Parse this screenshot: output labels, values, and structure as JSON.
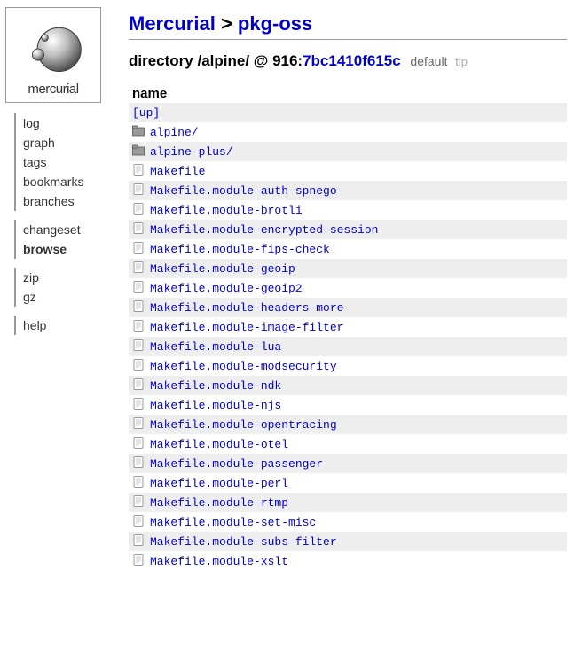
{
  "logo_text": "mercurial",
  "nav": {
    "group1": [
      "log",
      "graph",
      "tags",
      "bookmarks",
      "branches"
    ],
    "group2": [
      "changeset",
      "browse"
    ],
    "group3": [
      "zip",
      "gz"
    ],
    "group4": [
      "help"
    ],
    "active": "browse"
  },
  "breadcrumb": {
    "root": "Mercurial",
    "sep": " > ",
    "repo": "pkg-oss"
  },
  "subtitle": {
    "prefix": "directory /alpine/ @ 916:",
    "hash": "7bc1410f615c",
    "tag1": "default",
    "tag2": "tip"
  },
  "table_header": "name",
  "up_label": "[up]",
  "entries": [
    {
      "type": "dir",
      "name": "alpine/"
    },
    {
      "type": "dir",
      "name": "alpine-plus/"
    },
    {
      "type": "file",
      "name": "Makefile"
    },
    {
      "type": "file",
      "name": "Makefile.module-auth-spnego"
    },
    {
      "type": "file",
      "name": "Makefile.module-brotli"
    },
    {
      "type": "file",
      "name": "Makefile.module-encrypted-session"
    },
    {
      "type": "file",
      "name": "Makefile.module-fips-check"
    },
    {
      "type": "file",
      "name": "Makefile.module-geoip"
    },
    {
      "type": "file",
      "name": "Makefile.module-geoip2"
    },
    {
      "type": "file",
      "name": "Makefile.module-headers-more"
    },
    {
      "type": "file",
      "name": "Makefile.module-image-filter"
    },
    {
      "type": "file",
      "name": "Makefile.module-lua"
    },
    {
      "type": "file",
      "name": "Makefile.module-modsecurity"
    },
    {
      "type": "file",
      "name": "Makefile.module-ndk"
    },
    {
      "type": "file",
      "name": "Makefile.module-njs"
    },
    {
      "type": "file",
      "name": "Makefile.module-opentracing"
    },
    {
      "type": "file",
      "name": "Makefile.module-otel"
    },
    {
      "type": "file",
      "name": "Makefile.module-passenger"
    },
    {
      "type": "file",
      "name": "Makefile.module-perl"
    },
    {
      "type": "file",
      "name": "Makefile.module-rtmp"
    },
    {
      "type": "file",
      "name": "Makefile.module-set-misc"
    },
    {
      "type": "file",
      "name": "Makefile.module-subs-filter"
    },
    {
      "type": "file",
      "name": "Makefile.module-xslt"
    }
  ]
}
